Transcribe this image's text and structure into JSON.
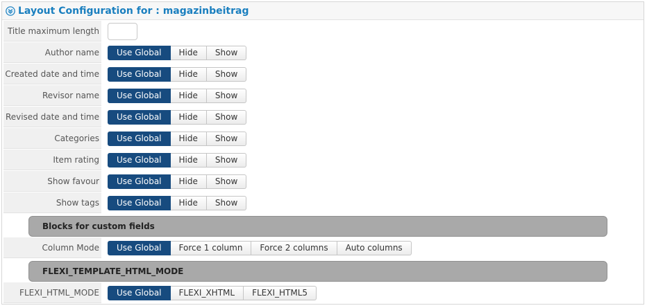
{
  "header": {
    "title": "Layout Configuration for : magazinbeitrag",
    "collapse_icon": "chevron-down-circle-icon"
  },
  "colors": {
    "accent": "#1a7fbf",
    "active_button": "#174b7f",
    "section_bar": "#a9a9a9"
  },
  "title_max_length": {
    "label": "Title maximum length",
    "value": ""
  },
  "display_options": {
    "buttons": [
      "Use Global",
      "Hide",
      "Show"
    ],
    "selected": "Use Global",
    "rows": [
      {
        "label": "Author name"
      },
      {
        "label": "Created date and time"
      },
      {
        "label": "Revisor name"
      },
      {
        "label": "Revised date and time"
      },
      {
        "label": "Categories"
      },
      {
        "label": "Item rating"
      },
      {
        "label": "Show favour"
      },
      {
        "label": "Show tags"
      }
    ]
  },
  "custom_fields_section": {
    "title": "Blocks for custom fields",
    "column_mode": {
      "label": "Column Mode",
      "buttons": [
        "Use Global",
        "Force 1 column",
        "Force 2 columns",
        "Auto columns"
      ],
      "selected": "Use Global"
    }
  },
  "template_section": {
    "title": "FLEXI_TEMPLATE_HTML_MODE",
    "html_mode": {
      "label": "FLEXI_HTML_MODE",
      "buttons": [
        "Use Global",
        "FLEXI_XHTML",
        "FLEXI_HTML5"
      ],
      "selected": "Use Global"
    }
  }
}
